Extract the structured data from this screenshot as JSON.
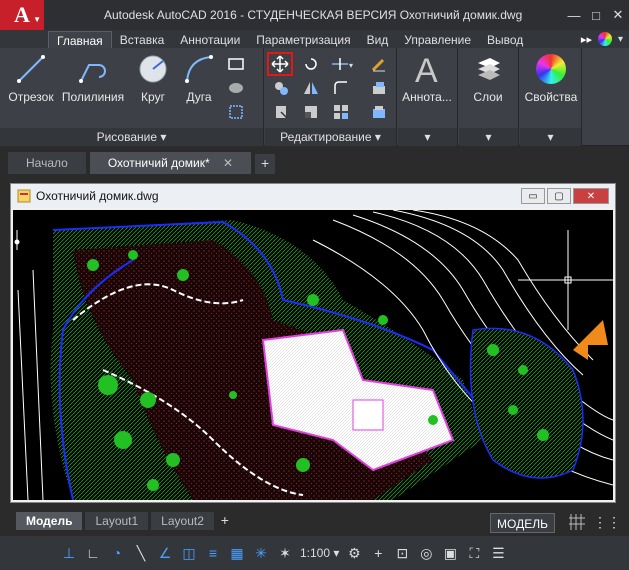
{
  "app": {
    "logo_letter": "A",
    "title": "Autodesk AutoCAD 2016 - СТУДЕНЧЕСКАЯ ВЕРСИЯ    Охотничий домик.dwg"
  },
  "window_controls": {
    "minimize": "—",
    "maximize": "□",
    "close": "✕"
  },
  "ribbon_tabs": [
    "Главная",
    "Вставка",
    "Аннотации",
    "Параметризация",
    "Вид",
    "Управление",
    "Вывод"
  ],
  "ribbon_more": "▸▸",
  "ribbon": {
    "draw_tools": [
      {
        "label": "Отрезок",
        "icon": "line-icon"
      },
      {
        "label": "Полилиния",
        "icon": "polyline-icon"
      },
      {
        "label": "Круг",
        "icon": "circle-icon"
      },
      {
        "label": "Дуга",
        "icon": "arc-icon"
      }
    ],
    "draw_panel_label": "Рисование ▾",
    "modify_panel_label": "Редактирование ▾",
    "annot_label": "Аннота...",
    "layers_label": "Слои",
    "props_label": "Свойства",
    "dropdown_caret": "▾"
  },
  "doc_tabs": [
    {
      "label": "Начало",
      "active": false
    },
    {
      "label": "Охотничий домик*",
      "active": true
    }
  ],
  "doc_tab_close": "✕",
  "doc_tab_add": "+",
  "drawing_window": {
    "title": "Охотничий домик.dwg",
    "ctrl_min": "▭",
    "ctrl_max": "▢",
    "ctrl_close": "✕"
  },
  "layout_tabs": [
    "Модель",
    "Layout1",
    "Layout2"
  ],
  "layout_add": "+",
  "model_label": "МОДЕЛЬ",
  "status": {
    "scale": "1:100 ▾"
  },
  "colors": {
    "background": "#000000",
    "terrain_green": "#1fa31f",
    "contour_white": "#ffffff",
    "boundary_blue": "#1a2cff",
    "building_magenta": "#e040e0",
    "tree_green": "#22c022",
    "accent_red": "#c8202a"
  }
}
